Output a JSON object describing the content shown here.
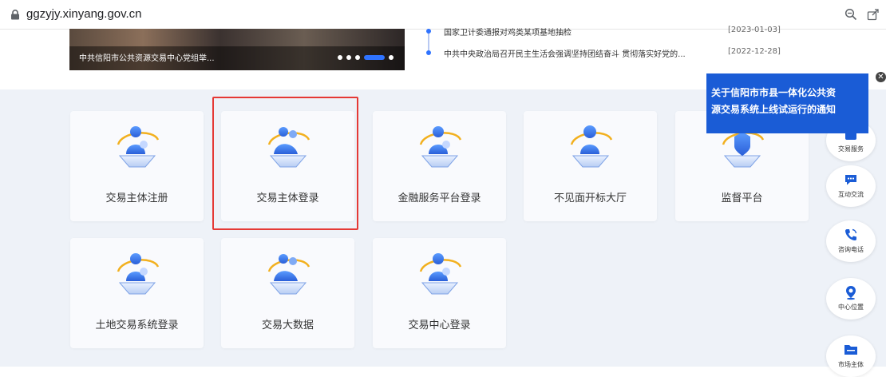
{
  "browser": {
    "url": "ggzyjy.xinyang.gov.cn"
  },
  "slideshow": {
    "caption": "中共信阳市公共资源交易中心党组举..."
  },
  "news": [
    {
      "title": "国家卫计委通报对鸡类某项基地抽检",
      "date": "[2023-01-03]"
    },
    {
      "title": "中共中央政治局召开民主生活会强调坚持团结奋斗 贯彻落实好党的...",
      "date": "[2022-12-28]"
    }
  ],
  "tiles": [
    {
      "label": "交易主体注册"
    },
    {
      "label": "交易主体登录"
    },
    {
      "label": "金融服务平台登录"
    },
    {
      "label": "不见面开标大厅"
    },
    {
      "label": "监督平台"
    },
    {
      "label": "土地交易系统登录"
    },
    {
      "label": "交易大数据"
    },
    {
      "label": "交易中心登录"
    }
  ],
  "notice": {
    "line1": "关于信阳市市县一体化公共资",
    "line2": "源交易系统上线试运行的通知"
  },
  "rail": [
    {
      "label": "交易服务"
    },
    {
      "label": "互动交流"
    },
    {
      "label": "咨询电话"
    },
    {
      "label": "中心位置"
    },
    {
      "label": "市场主体"
    }
  ],
  "colors": {
    "accent": "#1a5cd6",
    "highlight": "#e53935",
    "background": "#eef2f8"
  }
}
